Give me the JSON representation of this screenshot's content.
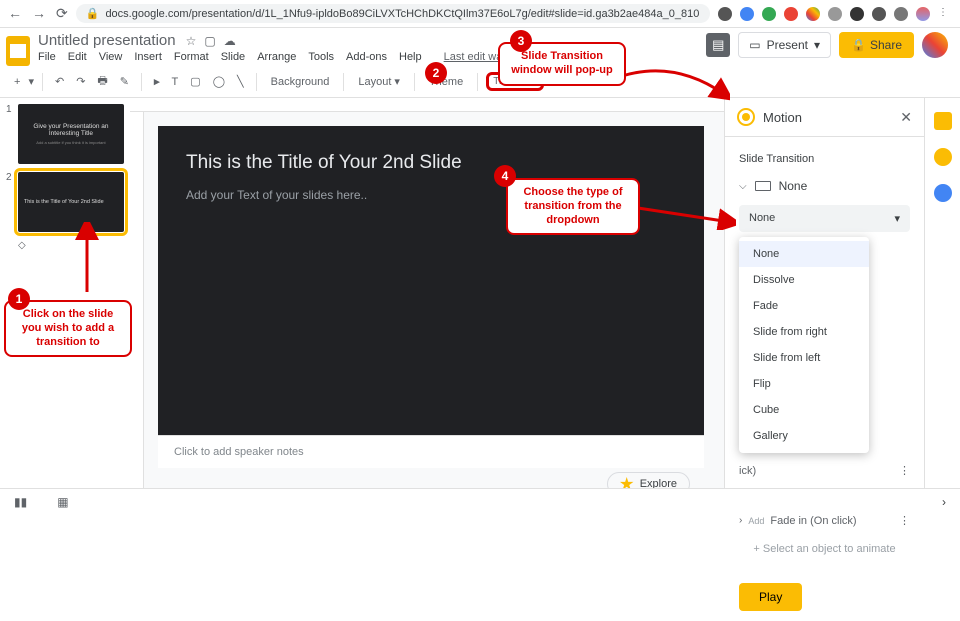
{
  "browser": {
    "url": "docs.google.com/presentation/d/1L_1Nfu9-ipldoBo89CiLVXTcHChDKCtQIlm37E6oL7g/edit#slide=id.ga3b2ae484a_0_810"
  },
  "doc": {
    "title": "Untitled presentation",
    "last_edit": "Last edit was 21 minutes ago"
  },
  "menu": [
    "File",
    "Edit",
    "View",
    "Insert",
    "Format",
    "Slide",
    "Arrange",
    "Tools",
    "Add-ons",
    "Help"
  ],
  "header_buttons": {
    "present": "Present",
    "share": "Share"
  },
  "toolbar": {
    "background": "Background",
    "layout": "Layout",
    "theme": "Theme",
    "transition": "Transition"
  },
  "thumbs": [
    {
      "num": "1",
      "title": "Give your Presentation an Interesting Title",
      "sub": "Add a subtitle if you think it is important"
    },
    {
      "num": "2",
      "title": "This is the Title of Your 2nd Slide",
      "sub": ""
    }
  ],
  "slide": {
    "title": "This is the Title of Your 2nd Slide",
    "body": "Add your Text of your slides here.."
  },
  "notes_placeholder": "Click to add speaker notes",
  "explore": "Explore",
  "motion": {
    "header": "Motion",
    "section": "Slide Transition",
    "current": "None",
    "dd_selected": "None",
    "options": [
      "None",
      "Dissolve",
      "Fade",
      "Slide from right",
      "Slide from left",
      "Flip",
      "Cube",
      "Gallery"
    ],
    "anim_more_1": "ick)",
    "anim_more_2": "ick)",
    "add_label": "Add",
    "anim_fadein": "Fade in  (On click)",
    "add_object": "+  Select an object to animate",
    "play": "Play"
  },
  "callouts": {
    "c1": "Click on the slide you wish to add a transition to",
    "c3": "Slide Transition window will pop-up",
    "c4": "Choose the type of transition from the dropdown"
  }
}
